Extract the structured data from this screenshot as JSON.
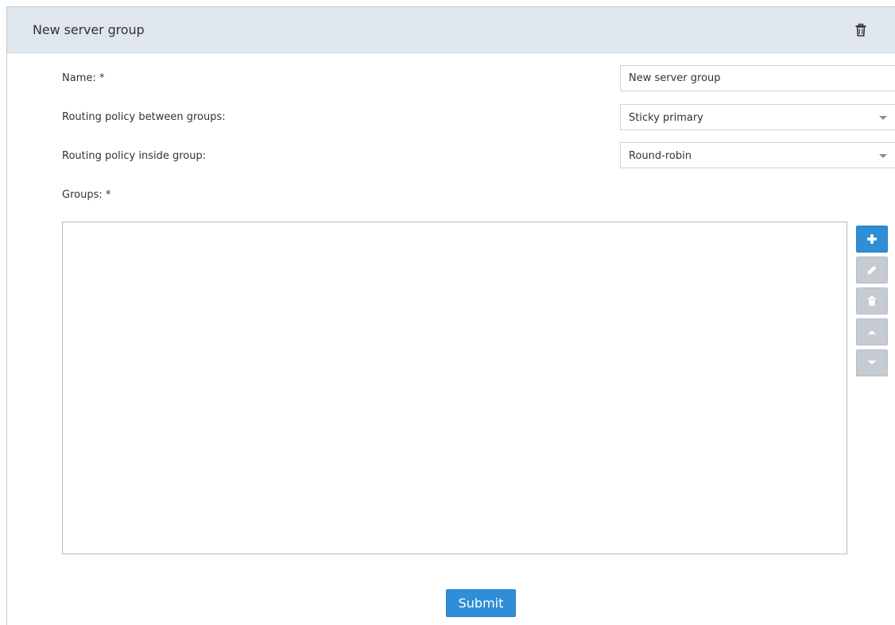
{
  "panel": {
    "title": "New server group",
    "header_icon": "trash-icon"
  },
  "form": {
    "name_label": "Name: *",
    "name_value": "New server group",
    "routing_between_label": "Routing policy between groups:",
    "routing_between_value": "Sticky primary",
    "routing_inside_label": "Routing policy inside group:",
    "routing_inside_value": "Round-robin",
    "groups_label": "Groups: *",
    "groups_items": []
  },
  "group_actions": [
    {
      "name": "add",
      "icon": "plus-icon",
      "enabled": true
    },
    {
      "name": "edit",
      "icon": "pencil-icon",
      "enabled": false
    },
    {
      "name": "delete",
      "icon": "trash-icon",
      "enabled": false
    },
    {
      "name": "move-up",
      "icon": "caret-up-icon",
      "enabled": false
    },
    {
      "name": "move-down",
      "icon": "caret-down-icon",
      "enabled": false
    }
  ],
  "submit_label": "Submit",
  "colors": {
    "header_bg": "#dfe6ed",
    "primary": "#2e8ed8",
    "disabled": "#c5cbd1"
  }
}
